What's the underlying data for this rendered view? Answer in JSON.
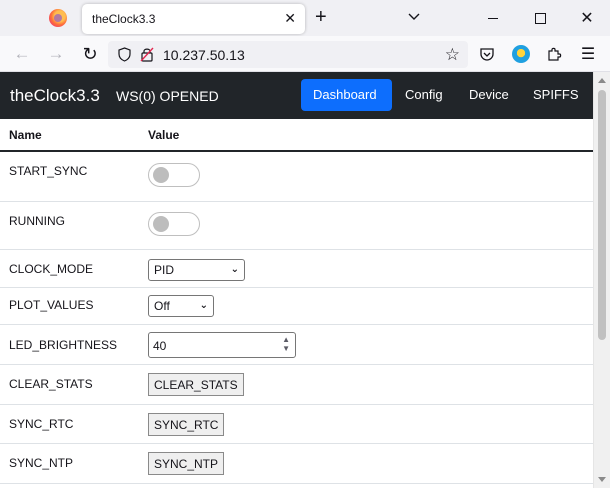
{
  "browser": {
    "tab_title": "theClock3.3",
    "tab_close": "✕",
    "new_tab": "+",
    "url": "10.237.50.13",
    "icons": [
      "firefox-logo",
      "back-icon",
      "forward-icon",
      "reload-icon",
      "shield-icon",
      "insecure-lock-icon",
      "bookmark-star-icon",
      "pocket-icon",
      "account-icon",
      "extensions-icon",
      "menu-icon"
    ]
  },
  "app": {
    "brand": "theClock3.3",
    "ws_status": "WS(0) OPENED",
    "nav": [
      {
        "label": "Dashboard",
        "active": true
      },
      {
        "label": "Config",
        "active": false
      },
      {
        "label": "Device",
        "active": false
      },
      {
        "label": "SPIFFS",
        "active": false
      }
    ],
    "accent_color": "#0d6efd",
    "navbar_color": "#212529"
  },
  "table": {
    "headers": [
      "Name",
      "Value"
    ],
    "rows": [
      {
        "name": "START_SYNC",
        "control": "toggle",
        "checked": false
      },
      {
        "name": "RUNNING",
        "control": "toggle",
        "checked": false
      },
      {
        "name": "CLOCK_MODE",
        "control": "select",
        "value": "PID"
      },
      {
        "name": "PLOT_VALUES",
        "control": "select",
        "value": "Off"
      },
      {
        "name": "LED_BRIGHTNESS",
        "control": "number",
        "value": "40"
      },
      {
        "name": "CLEAR_STATS",
        "control": "button",
        "value": "CLEAR_STATS"
      },
      {
        "name": "SYNC_RTC",
        "control": "button",
        "value": "SYNC_RTC"
      },
      {
        "name": "SYNC_NTP",
        "control": "button",
        "value": "SYNC_NTP"
      }
    ]
  }
}
